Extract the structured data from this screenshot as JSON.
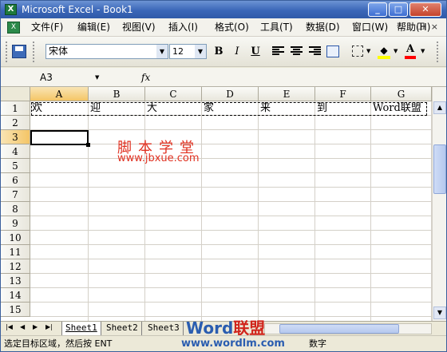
{
  "window": {
    "title": "Microsoft Excel - Book1",
    "app_icon": "excel-icon",
    "controls": [
      "minimize-icon",
      "maximize-icon",
      "close-icon"
    ]
  },
  "menu": {
    "items": [
      "文件(F)",
      "编辑(E)",
      "视图(V)",
      "插入(I)",
      "格式(O)",
      "工具(T)",
      "数据(D)",
      "窗口(W)",
      "帮助(H)"
    ],
    "doc_controls": "- ❐ ×"
  },
  "toolbar": {
    "font_name": "宋体",
    "font_size": "12",
    "bold": "B",
    "italic": "I",
    "underline": "U",
    "font_color_glyph": "A",
    "fill_color": "#ffff00",
    "font_color": "#ff0000"
  },
  "formula_bar": {
    "name_box": "A3",
    "fx": "fx",
    "content": ""
  },
  "grid": {
    "columns": [
      "A",
      "B",
      "C",
      "D",
      "E",
      "F",
      "G"
    ],
    "rows": [
      "1",
      "2",
      "3",
      "4",
      "5",
      "6",
      "7",
      "8",
      "9",
      "10",
      "11",
      "12",
      "13",
      "14",
      "15"
    ],
    "row1_cells": [
      "欢",
      "迎",
      "大",
      "家",
      "来",
      "到",
      "Word联盟"
    ],
    "active_cell": "A3"
  },
  "watermark": {
    "cn": "脚本学堂",
    "url": "www.jbxue.com",
    "brand_word": "Word",
    "brand_cn": "联盟",
    "brand_url": "www.wordlm.com"
  },
  "sheets": {
    "tabs": [
      "Sheet1",
      "Sheet2",
      "Sheet3"
    ],
    "active": "Sheet1"
  },
  "status": {
    "message": "选定目标区域，然后按 ENT",
    "mode": "数字"
  }
}
